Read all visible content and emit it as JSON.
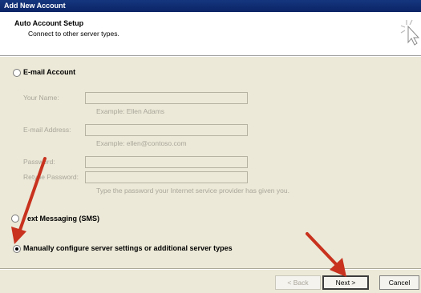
{
  "window": {
    "title": "Add New Account"
  },
  "header": {
    "title": "Auto Account Setup",
    "subtitle": "Connect to other server types.",
    "icon": "cursor-sparkle-icon"
  },
  "options": {
    "email_account": {
      "label": "E-mail Account",
      "checked": false
    },
    "text_messaging": {
      "label": "Text Messaging (SMS)",
      "visible_label": "ext Messaging (SMS)",
      "checked": false
    },
    "manual": {
      "label": "Manually configure server settings or additional server types",
      "checked": true
    }
  },
  "form": {
    "your_name": {
      "label": "Your Name:",
      "value": "",
      "hint": "Example: Ellen Adams"
    },
    "email_address": {
      "label": "E-mail Address:",
      "value": "",
      "hint": "Example: ellen@contoso.com"
    },
    "password": {
      "label": "Password:",
      "value": ""
    },
    "retype_password": {
      "label": "Retype Password:",
      "value": ""
    },
    "password_hint": "Type the password your Internet service provider has given you."
  },
  "buttons": {
    "back": "< Back",
    "next": "Next >",
    "cancel": "Cancel"
  },
  "annotations": {
    "arrow_color": "#c8321e"
  }
}
